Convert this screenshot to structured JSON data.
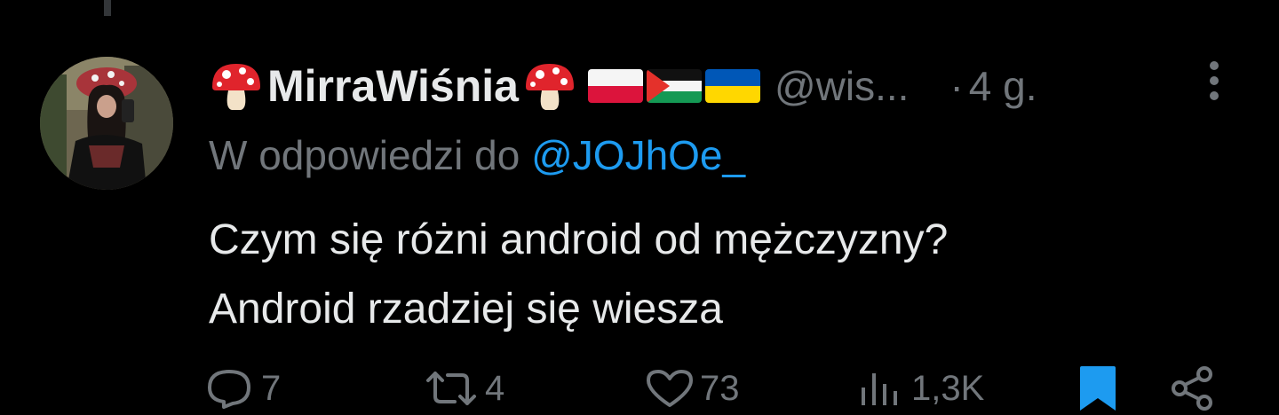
{
  "tweet": {
    "display_name": "MirraWiśnia",
    "name_emoji_left": "mushroom-icon",
    "name_emoji_right": "mushroom-icon",
    "flags": [
      "poland-flag-icon",
      "palestine-flag-icon",
      "ukraine-flag-icon"
    ],
    "handle": "@wis...",
    "separator": "·",
    "time": "4 g.",
    "reply_prefix": "W odpowiedzi do",
    "reply_mention": "@JOJhOe_",
    "text_lines": [
      "Czym się różni android od mężczyzny?",
      "Android rzadziej się wiesza"
    ]
  },
  "actions": {
    "replies": "7",
    "reposts": "4",
    "likes": "73",
    "views": "1,3K"
  },
  "colors": {
    "background": "#000000",
    "text": "#e7e9ea",
    "muted": "#71767b",
    "accent": "#1d9bf0"
  }
}
